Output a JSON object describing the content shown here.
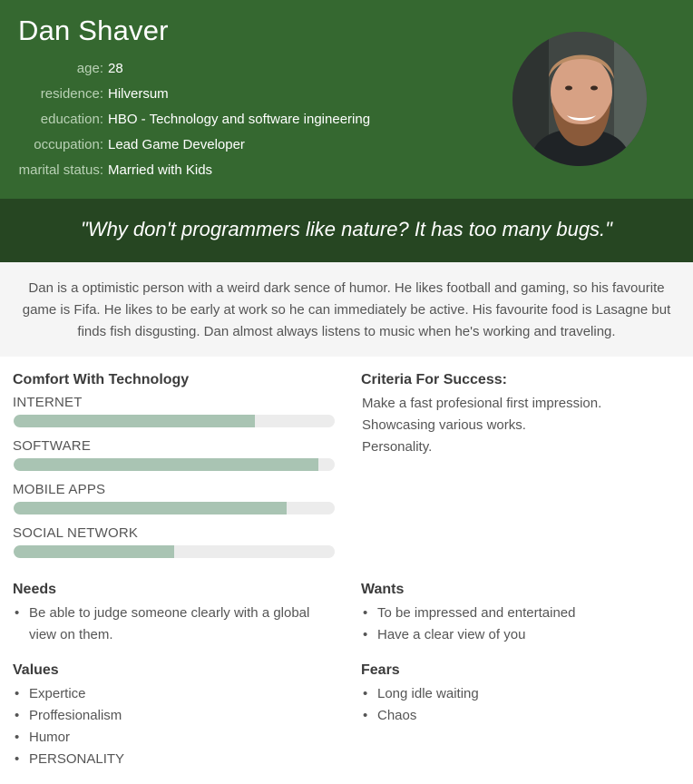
{
  "profile": {
    "name": "Dan Shaver",
    "fields": [
      {
        "label": "age:",
        "value": "28"
      },
      {
        "label": "residence:",
        "value": "Hilversum"
      },
      {
        "label": "education:",
        "value": "HBO - Technology and software ingineering"
      },
      {
        "label": "occupation:",
        "value": "Lead Game Developer"
      },
      {
        "label": "marital status:",
        "value": "Married with Kids"
      }
    ],
    "avatar_icon": "profile-photo",
    "quote": "\"Why don't programmers like nature? It has too many bugs.\"",
    "bio": "Dan is a optimistic person with a weird dark sence of humor. He likes football and gaming, so his favourite game is Fifa. He likes to be early at work so he can immediately be active. His favourite food is Lasagne but finds fish disgusting. Dan almost always listens to music when he's working and traveling."
  },
  "technology": {
    "title": "Comfort With Technology",
    "skills": [
      {
        "label": "INTERNET",
        "level": 0.75
      },
      {
        "label": "SOFTWARE",
        "level": 0.95
      },
      {
        "label": "MOBILE APPS",
        "level": 0.85
      },
      {
        "label": "SOCIAL NETWORK",
        "level": 0.5
      }
    ]
  },
  "success": {
    "title": "Criteria For Success:",
    "items": [
      "Make a fast profesional first impression.",
      "Showcasing various works.",
      "Personality."
    ]
  },
  "needs": {
    "title": "Needs",
    "items": [
      "Be able to judge someone clearly with a global view on them."
    ]
  },
  "wants": {
    "title": "Wants",
    "items": [
      "To be impressed and entertained",
      "Have a clear view of you"
    ]
  },
  "values": {
    "title": "Values",
    "items": [
      "Expertice",
      "Proffesionalism",
      "Humor",
      "PERSONALITY"
    ]
  },
  "fears": {
    "title": "Fears",
    "items": [
      "Long idle waiting",
      "Chaos"
    ]
  },
  "colors": {
    "header": "#356830",
    "quote_bar": "#264622",
    "bar_fill": "#a9c4b3",
    "bar_track": "#ececec"
  }
}
